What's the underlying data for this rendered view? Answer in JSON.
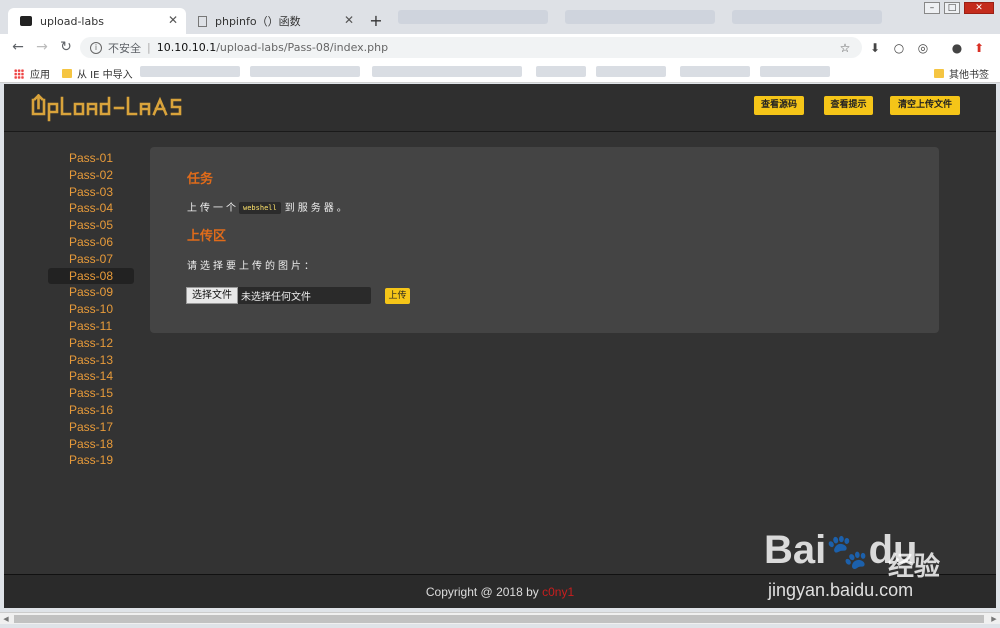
{
  "browser": {
    "tabs": [
      {
        "title": "upload-labs",
        "active": true
      },
      {
        "title": "phpinfo（）函数",
        "active": false
      }
    ],
    "new_tab": "+",
    "url": {
      "security": "不安全",
      "host": "10.10.10.1",
      "path": "/upload-labs/Pass-08/index.php"
    },
    "bookmarks": {
      "apps": "应用",
      "import_ie": "从 IE 中导入",
      "other": "其他书签"
    }
  },
  "header": {
    "logo_text": "UpLoad-labs",
    "buttons": [
      "查看源码",
      "查看提示",
      "清空上传文件"
    ]
  },
  "sidebar": {
    "active": "Pass-08",
    "items": [
      "Pass-01",
      "Pass-02",
      "Pass-03",
      "Pass-04",
      "Pass-05",
      "Pass-06",
      "Pass-07",
      "Pass-08",
      "Pass-09",
      "Pass-10",
      "Pass-11",
      "Pass-12",
      "Pass-13",
      "Pass-14",
      "Pass-15",
      "Pass-16",
      "Pass-17",
      "Pass-18",
      "Pass-19"
    ]
  },
  "main": {
    "task_title": "任务",
    "task_prefix": "上传一个",
    "task_code": "webshell",
    "task_suffix": "到服务器。",
    "upload_title": "上传区",
    "prompt": "请选择要上传的图片：",
    "choose_button": "选择文件",
    "no_file": "未选择任何文件",
    "upload_button": "上传"
  },
  "footer": {
    "copyright": "Copyright @ 2018 by ",
    "author": "c0ny1"
  },
  "watermark": {
    "brand": "Bai",
    "brand2": "du",
    "jy": "经验",
    "url": "jingyan.baidu.com"
  },
  "colors": {
    "accent": "#f5c518",
    "nav_link": "#e89b3a",
    "heading": "#e06b1a",
    "author": "#c81e1e"
  }
}
